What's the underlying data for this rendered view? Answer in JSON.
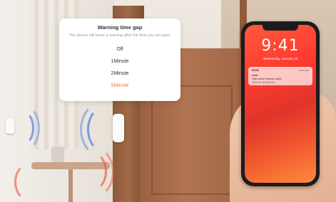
{
  "dialog": {
    "title": "Warning time gap",
    "description": "The device will issue a warning after the time you set pass.",
    "options": [
      "Off",
      "1Minute",
      "2Minute",
      "5Minute"
    ],
    "selected": "5Minute",
    "accent_color": "#f07b32"
  },
  "phone": {
    "time": "9:41",
    "date": "Wednesday, January 15",
    "notification": {
      "app": "EZVIZ",
      "time": "Just now",
      "line1": "ezviz",
      "line2": "Open-close Detector alarm",
      "line3": "2020-01-15 09:41:00"
    }
  }
}
